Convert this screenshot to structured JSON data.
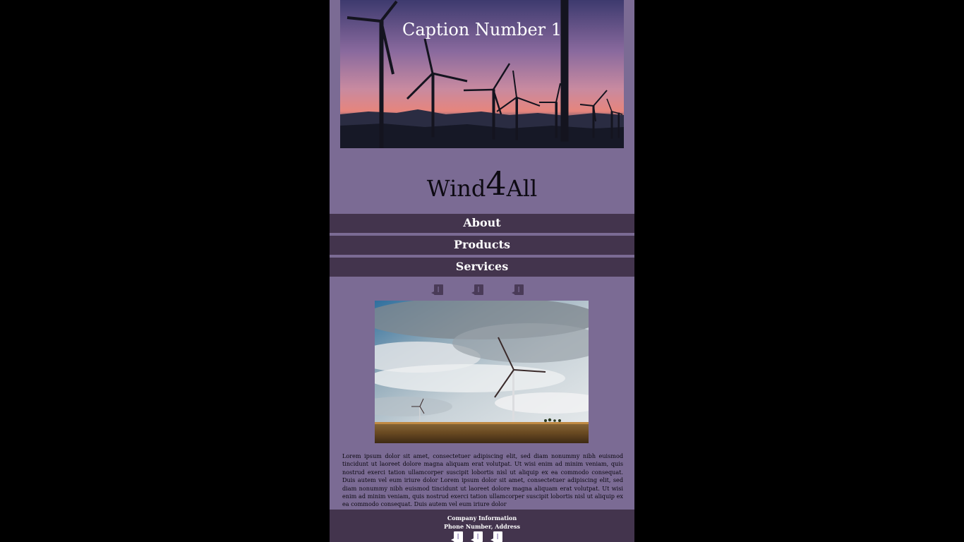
{
  "hero": {
    "caption": "Caption Number 1"
  },
  "logo": {
    "part1": "Wind",
    "part2": "4",
    "part3": "All"
  },
  "nav": {
    "items": [
      {
        "label": "About"
      },
      {
        "label": "Products"
      },
      {
        "label": "Services"
      }
    ]
  },
  "social_top": {
    "icons": [
      "social-icon-1",
      "social-icon-2",
      "social-icon-3"
    ],
    "color": "#4a3b58"
  },
  "content": {
    "paragraph": "Lorem ipsum dolor sit amet, consectetuer adipiscing elit, sed diam nonummy nibh euismod tincidunt ut laoreet dolore magna aliquam erat volutpat. Ut wisi enim ad minim veniam, quis nostrud exerci tation ullamcorper suscipit lobortis nisl ut aliquip ex ea commodo consequat. Duis autem vel eum iriure dolor Lorem ipsum dolor sit amet, consectetuer adipiscing elit, sed diam nonummy nibh euismod tincidunt ut laoreet dolore magna aliquam erat volutpat. Ut wisi enim ad minim veniam, quis nostrud exerci tation ullamcorper suscipit lobortis nisl ut aliquip ex ea commodo consequat. Duis autem vel eum iriure dolor"
  },
  "footer": {
    "company_info": "Company Information",
    "contact": "Phone Number, Address",
    "icons": [
      "social-icon-1",
      "social-icon-2",
      "social-icon-3"
    ],
    "icon_color": "#ffffff"
  },
  "colors": {
    "page_background": "#7b6b94",
    "outer_background": "#000000",
    "nav_background": "#43344d",
    "nav_text": "#ffffff"
  }
}
